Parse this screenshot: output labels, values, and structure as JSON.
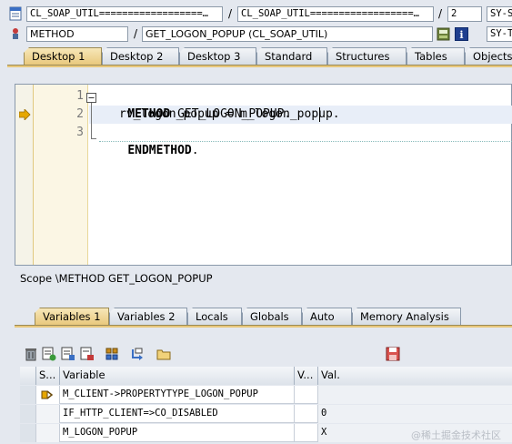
{
  "header": {
    "row1": {
      "field1": "CL_SOAP_UTIL==================…",
      "field2": "CL_SOAP_UTIL==================…",
      "line": "2",
      "sy_field": "SY-S"
    },
    "row2": {
      "kind": "METHOD",
      "method": "GET_LOGON_POPUP (CL_SOAP_UTIL)",
      "sy_field": "SY-T"
    },
    "separator": "/"
  },
  "desktop_tabs": [
    "Desktop 1",
    "Desktop 2",
    "Desktop 3",
    "Standard",
    "Structures",
    "Tables",
    "Objects"
  ],
  "editor": {
    "line_numbers": [
      "1",
      "2",
      "3"
    ],
    "line1_kw": "METHOD",
    "line1_rest": " GET_LOGON_POPUP.",
    "line2": "rv_logon_popup = m_logon_popup.",
    "line3_kw": "ENDMETHOD",
    "line3_rest": "."
  },
  "scope": "Scope \\METHOD GET_LOGON_POPUP",
  "variable_tabs": [
    "Variables 1",
    "Variables 2",
    "Locals",
    "Globals",
    "Auto",
    "Memory Analysis"
  ],
  "table": {
    "headers": [
      "S...",
      "Variable",
      "V...",
      "Val."
    ],
    "rows": [
      {
        "variable": "M_CLIENT->PROPERTYTYPE_LOGON_POPUP",
        "value": ""
      },
      {
        "variable": "IF_HTTP_CLIENT=>CO_DISABLED",
        "value": "0"
      },
      {
        "variable": "M_LOGON_POPUP",
        "value": "X"
      }
    ]
  },
  "watermark": "@稀土掘金技术社区",
  "colors": {
    "active_tab": "#e8c77a",
    "background": "#e4e8ef",
    "breakpoint_arrow": "#e6a700"
  }
}
